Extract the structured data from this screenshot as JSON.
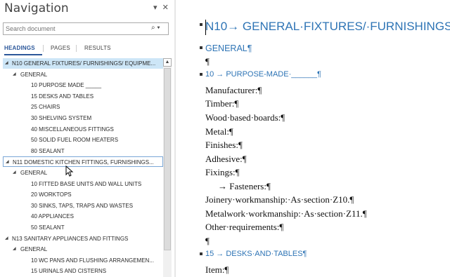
{
  "nav": {
    "title": "Navigation",
    "dropdown_glyph": "▾",
    "close_glyph": "✕",
    "search": {
      "placeholder": "Search document",
      "icon": "search-icon",
      "icon_glyph": "⌕",
      "dropdown_glyph": "▾"
    },
    "tabs": [
      {
        "label": "HEADINGS",
        "active": true
      },
      {
        "label": "PAGES",
        "active": false
      },
      {
        "label": "RESULTS",
        "active": false
      }
    ],
    "tree": [
      {
        "id": "n10",
        "label": "N10 GENERAL FIXTURES/ FURNISHINGS/ EQUIPME...",
        "level": 0,
        "expanded": true,
        "selected": true
      },
      {
        "id": "n10-general",
        "label": "GENERAL",
        "level": 1,
        "expanded": true
      },
      {
        "id": "n10-10",
        "label": "10 PURPOSE MADE _____",
        "level": 2
      },
      {
        "id": "n10-15",
        "label": "15 DESKS AND TABLES",
        "level": 2
      },
      {
        "id": "n10-25",
        "label": "25 CHAIRS",
        "level": 2
      },
      {
        "id": "n10-30",
        "label": "30 SHELVING SYSTEM",
        "level": 2
      },
      {
        "id": "n10-40",
        "label": "40 MISCELLANEOUS FITTINGS",
        "level": 2
      },
      {
        "id": "n10-50",
        "label": "50 SOLID FUEL ROOM HEATERS",
        "level": 2
      },
      {
        "id": "n10-80",
        "label": "80 SEALANT",
        "level": 2
      },
      {
        "id": "n11",
        "label": "N11 DOMESTIC KITCHEN FITTINGS, FURNISHINGS...",
        "level": 0,
        "expanded": true,
        "hovered": true
      },
      {
        "id": "n11-general",
        "label": "GENERAL",
        "level": 1,
        "expanded": true
      },
      {
        "id": "n11-10",
        "label": "10 FITTED BASE UNITS AND WALL UNITS",
        "level": 2
      },
      {
        "id": "n11-20",
        "label": "20 WORKTOPS",
        "level": 2
      },
      {
        "id": "n11-30",
        "label": "30 SINKS, TAPS, TRAPS AND WASTES",
        "level": 2
      },
      {
        "id": "n11-40",
        "label": "40 APPLIANCES",
        "level": 2
      },
      {
        "id": "n11-50",
        "label": "50 SEALANT",
        "level": 2
      },
      {
        "id": "n13",
        "label": "N13 SANITARY APPLIANCES AND FITTINGS",
        "level": 0,
        "expanded": true
      },
      {
        "id": "n13-general",
        "label": "GENERAL",
        "level": 1,
        "expanded": true
      },
      {
        "id": "n13-10",
        "label": "10 WC PANS AND FLUSHING ARRANGEMEN...",
        "level": 2
      },
      {
        "id": "n13-15",
        "label": "15 URINALS AND CISTERNS",
        "level": 2
      }
    ],
    "expand_glyph": "◢",
    "scroll_up_glyph": "▲"
  },
  "document": {
    "lines": [
      {
        "kind": "h1",
        "bullet": true,
        "text": "N10→ GENERAL·FIXTURES/·FURNISHINGS"
      },
      {
        "kind": "h2",
        "bullet": true,
        "text": "GENERAL¶"
      },
      {
        "kind": "body",
        "bullet": false,
        "text": "¶"
      },
      {
        "kind": "h3",
        "bullet": true,
        "text": "10  →  PURPOSE-MADE·______¶"
      },
      {
        "kind": "body",
        "bullet": false,
        "text": "Manufacturer:¶"
      },
      {
        "kind": "body",
        "bullet": false,
        "text": "Timber:¶"
      },
      {
        "kind": "body",
        "bullet": false,
        "text": "Wood·based·boards:¶"
      },
      {
        "kind": "body",
        "bullet": false,
        "text": "Metal:¶"
      },
      {
        "kind": "body",
        "bullet": false,
        "text": "Finishes:¶"
      },
      {
        "kind": "body",
        "bullet": false,
        "text": "Adhesive:¶"
      },
      {
        "kind": "body",
        "bullet": false,
        "text": "Fixings:¶"
      },
      {
        "kind": "body",
        "bullet": false,
        "text": "→    Fasteners:¶",
        "indent": true
      },
      {
        "kind": "body",
        "bullet": false,
        "text": "Joinery·workmanship:·As·section·Z10.¶"
      },
      {
        "kind": "body",
        "bullet": false,
        "text": "Metalwork·workmanship:·As·section·Z11.¶"
      },
      {
        "kind": "body",
        "bullet": false,
        "text": "Other·requirements:¶"
      },
      {
        "kind": "body",
        "bullet": false,
        "text": "¶"
      },
      {
        "kind": "h3",
        "bullet": true,
        "text": "15  →  DESKS·AND·TABLES¶"
      },
      {
        "kind": "body",
        "bullet": false,
        "text": "Item:¶"
      }
    ]
  },
  "colors": {
    "heading_blue": "#2e74b5",
    "tab_active": "#2b579a",
    "selection": "#cde6f7"
  }
}
